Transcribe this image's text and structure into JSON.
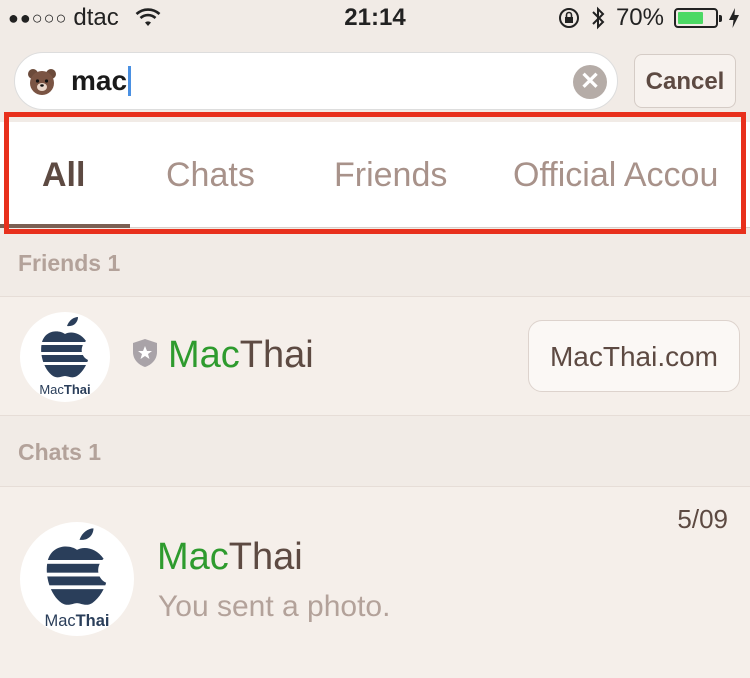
{
  "status_bar": {
    "signal": "●●○○○",
    "carrier": "dtac",
    "time": "21:14",
    "battery_percent": "70%",
    "battery_level": 0.7,
    "icons": [
      "wifi-icon",
      "orientation-lock-icon",
      "bluetooth-icon",
      "battery-icon",
      "charging-icon"
    ]
  },
  "search": {
    "query": "mac",
    "clear_icon": "clear-icon",
    "cancel_label": "Cancel"
  },
  "tabs": [
    {
      "label": "All",
      "active": true
    },
    {
      "label": "Chats",
      "active": false
    },
    {
      "label": "Friends",
      "active": false
    },
    {
      "label": "Official Accou",
      "active": false
    }
  ],
  "friends_section": {
    "header": "Friends 1",
    "item": {
      "name_highlight": "Mac",
      "name_rest": "Thai",
      "website": "MacThai.com",
      "avatar_text_a": "Mac",
      "avatar_text_b": "Thai"
    }
  },
  "chats_section": {
    "header": "Chats 1",
    "item": {
      "name_highlight": "Mac",
      "name_rest": "Thai",
      "date": "5/09",
      "preview": "You sent a photo.",
      "avatar_text_a": "Mac",
      "avatar_text_b": "Thai"
    }
  },
  "colors": {
    "background": "#f1ebe6",
    "highlight_green": "#2e9b2e",
    "annotation_red": "#e8301c",
    "battery_green": "#4cd964"
  }
}
